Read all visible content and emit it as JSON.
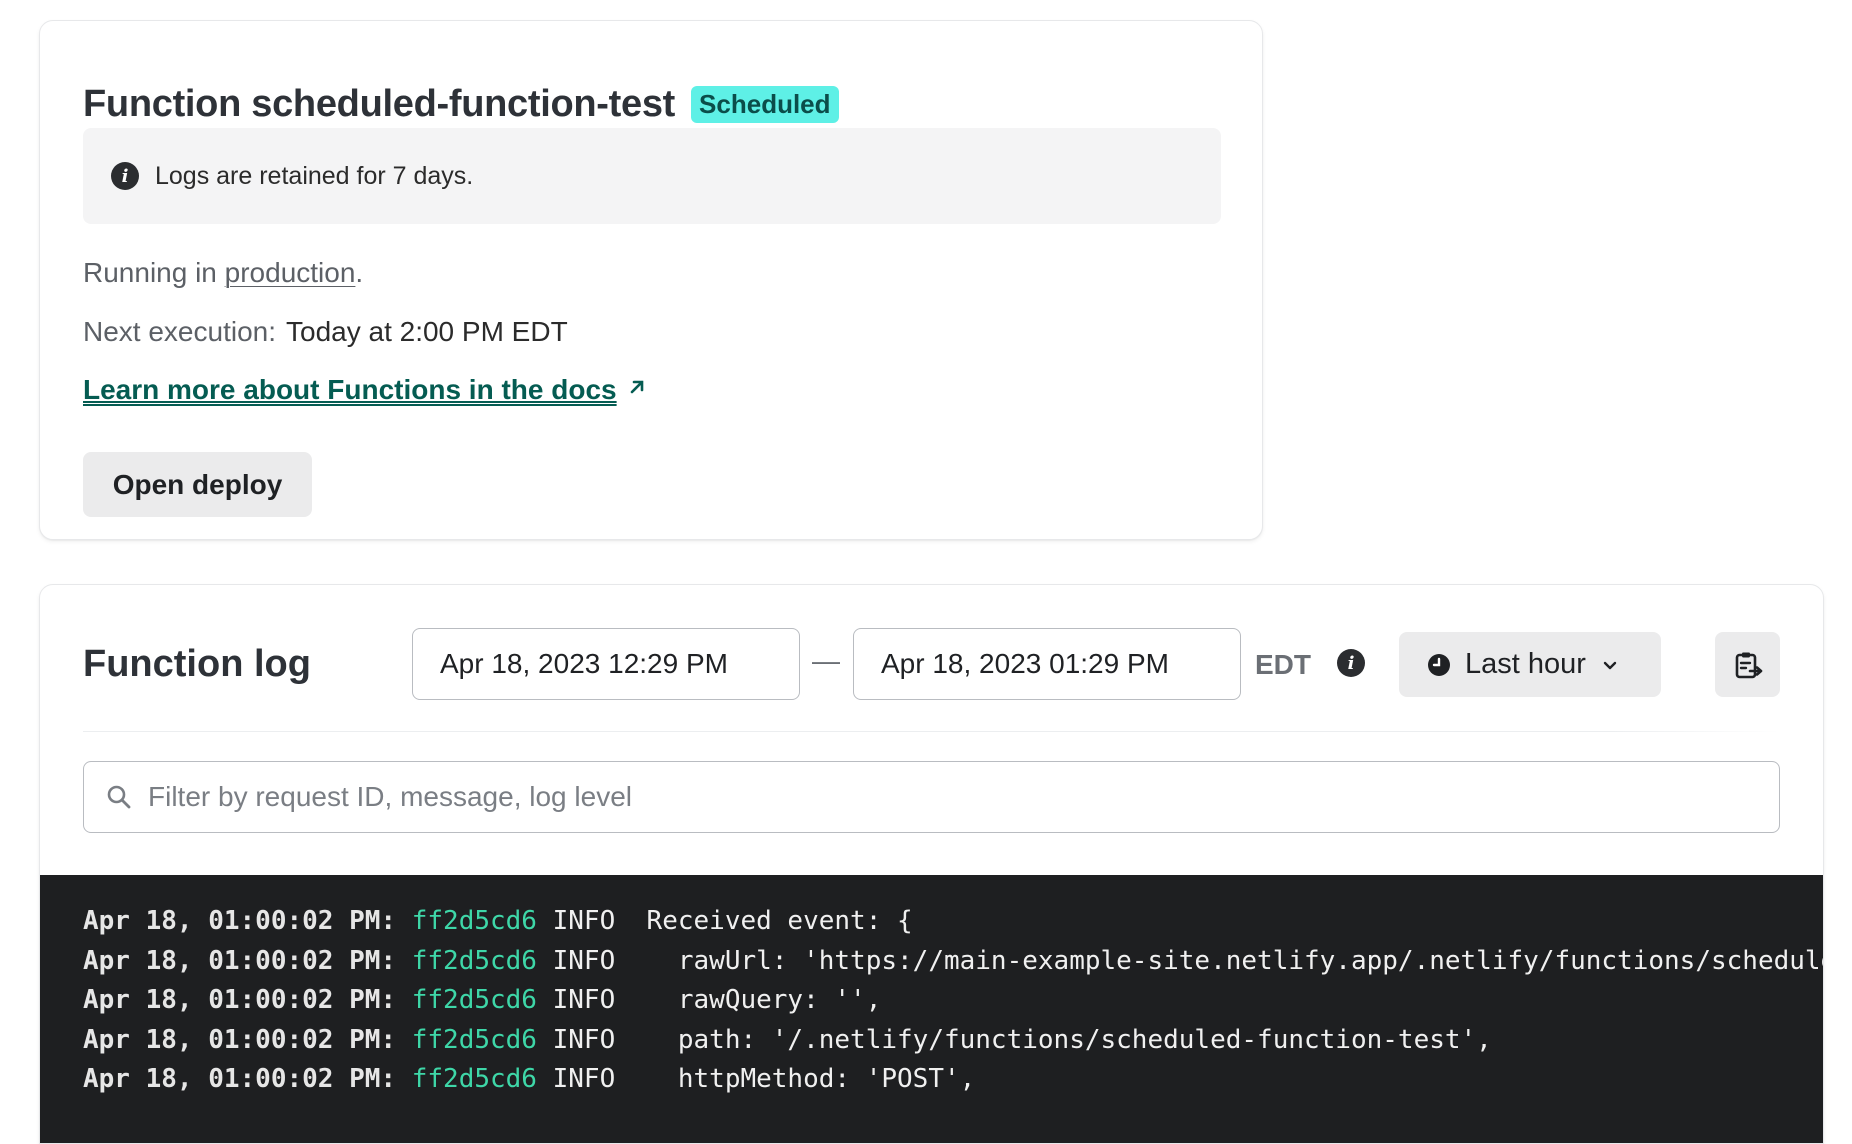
{
  "function_card": {
    "title": "Function scheduled-function-test",
    "badge": "Scheduled",
    "notice": "Logs are retained for 7 days.",
    "running_prefix": "Running in ",
    "running_link": "production",
    "running_suffix": ".",
    "next_execution_label": "Next execution:",
    "next_execution_value": "Today at 2:00 PM EDT",
    "docs_link": "Learn more about Functions in the docs",
    "open_deploy": "Open deploy"
  },
  "log_card": {
    "title": "Function log",
    "date_from": "Apr 18, 2023 12:29 PM",
    "dash": "—",
    "date_to": "Apr 18, 2023 01:29 PM",
    "timezone": "EDT",
    "range_button": "Last hour",
    "search_placeholder": "Filter by request ID, message, log level",
    "lines": [
      {
        "ts": "Apr 18, 01:00:02 PM:",
        "rid": "ff2d5cd6",
        "level": "INFO",
        "msg": "  Received event: {"
      },
      {
        "ts": "Apr 18, 01:00:02 PM:",
        "rid": "ff2d5cd6",
        "level": "INFO",
        "msg": "    rawUrl: 'https://main-example-site.netlify.app/.netlify/functions/scheduled-function-test',"
      },
      {
        "ts": "Apr 18, 01:00:02 PM:",
        "rid": "ff2d5cd6",
        "level": "INFO",
        "msg": "    rawQuery: '',"
      },
      {
        "ts": "Apr 18, 01:00:02 PM:",
        "rid": "ff2d5cd6",
        "level": "INFO",
        "msg": "    path: '/.netlify/functions/scheduled-function-test',"
      },
      {
        "ts": "Apr 18, 01:00:02 PM:",
        "rid": "ff2d5cd6",
        "level": "INFO",
        "msg": "    httpMethod: 'POST',"
      }
    ]
  },
  "colors": {
    "badge_bg": "#5ef0e6",
    "link_green": "#055c52",
    "request_id_green": "#3ed7a8",
    "console_bg": "#1e1f21"
  },
  "icons": {
    "notice": "info-icon",
    "timezone_info": "info-icon",
    "range": "clock-icon",
    "range_dropdown": "chevron-down-icon",
    "export": "clipboard-export-icon",
    "search": "search-icon",
    "external_link": "arrow-up-right-icon"
  }
}
